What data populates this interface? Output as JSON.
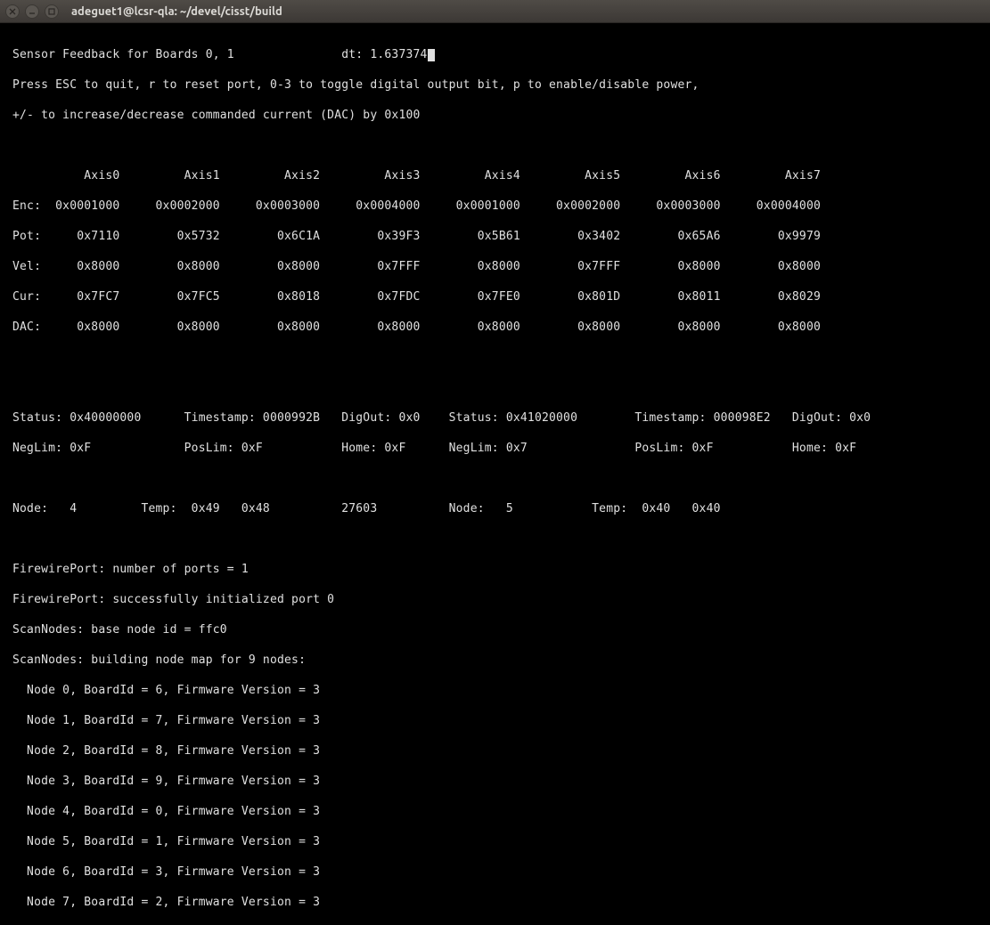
{
  "window": {
    "title": "adeguet1@lcsr-qla: ~/devel/cisst/build"
  },
  "header": {
    "title_prefix": "Sensor Feedback for Boards ",
    "boards": "0, 1",
    "dt_label": "dt: ",
    "dt_value": "1.637374",
    "help1": "Press ESC to quit, r to reset port, 0-3 to toggle digital output bit, p to enable/disable power,",
    "help2": "+/- to increase/decrease commanded current (DAC) by 0x100"
  },
  "axis_labels": [
    "Axis0",
    "Axis1",
    "Axis2",
    "Axis3",
    "Axis4",
    "Axis5",
    "Axis6",
    "Axis7"
  ],
  "rows": {
    "Enc": [
      "0x0001000",
      "0x0002000",
      "0x0003000",
      "0x0004000",
      "0x0001000",
      "0x0002000",
      "0x0003000",
      "0x0004000"
    ],
    "Pot": [
      "0x7110",
      "0x5732",
      "0x6C1A",
      "0x39F3",
      "0x5B61",
      "0x3402",
      "0x65A6",
      "0x9979"
    ],
    "Vel": [
      "0x8000",
      "0x8000",
      "0x8000",
      "0x7FFF",
      "0x8000",
      "0x7FFF",
      "0x8000",
      "0x8000"
    ],
    "Cur": [
      "0x7FC7",
      "0x7FC5",
      "0x8018",
      "0x7FDC",
      "0x7FE0",
      "0x801D",
      "0x8011",
      "0x8029"
    ],
    "DAC": [
      "0x8000",
      "0x8000",
      "0x8000",
      "0x8000",
      "0x8000",
      "0x8000",
      "0x8000",
      "0x8000"
    ]
  },
  "status_block": {
    "left": {
      "status": "0x40000000",
      "timestamp": "0000992B",
      "digout": "0x0",
      "neglim": "0xF",
      "poslim": "0xF",
      "home": "0xF",
      "node": "4",
      "temp1": "0x49",
      "temp2": "0x48",
      "extra": "27603"
    },
    "right": {
      "status": "0x41020000",
      "timestamp": "000098E2",
      "digout": "0x0",
      "neglim": "0x7",
      "poslim": "0xF",
      "home": "0xF",
      "node": "5",
      "temp1": "0x40",
      "temp2": "0x40"
    }
  },
  "log": {
    "l1": "FirewirePort: number of ports = 1",
    "l2": "FirewirePort: successfully initialized port 0",
    "l3": "ScanNodes: base node id = ffc0",
    "l4": "ScanNodes: building node map for 9 nodes:",
    "nodes": [
      {
        "node": "0",
        "board": "6",
        "fw": "3"
      },
      {
        "node": "1",
        "board": "7",
        "fw": "3"
      },
      {
        "node": "2",
        "board": "8",
        "fw": "3"
      },
      {
        "node": "3",
        "board": "9",
        "fw": "3"
      },
      {
        "node": "4",
        "board": "0",
        "fw": "3"
      },
      {
        "node": "5",
        "board": "1",
        "fw": "3"
      },
      {
        "node": "6",
        "board": "3",
        "fw": "3"
      },
      {
        "node": "7",
        "board": "2",
        "fw": "3"
      }
    ]
  }
}
